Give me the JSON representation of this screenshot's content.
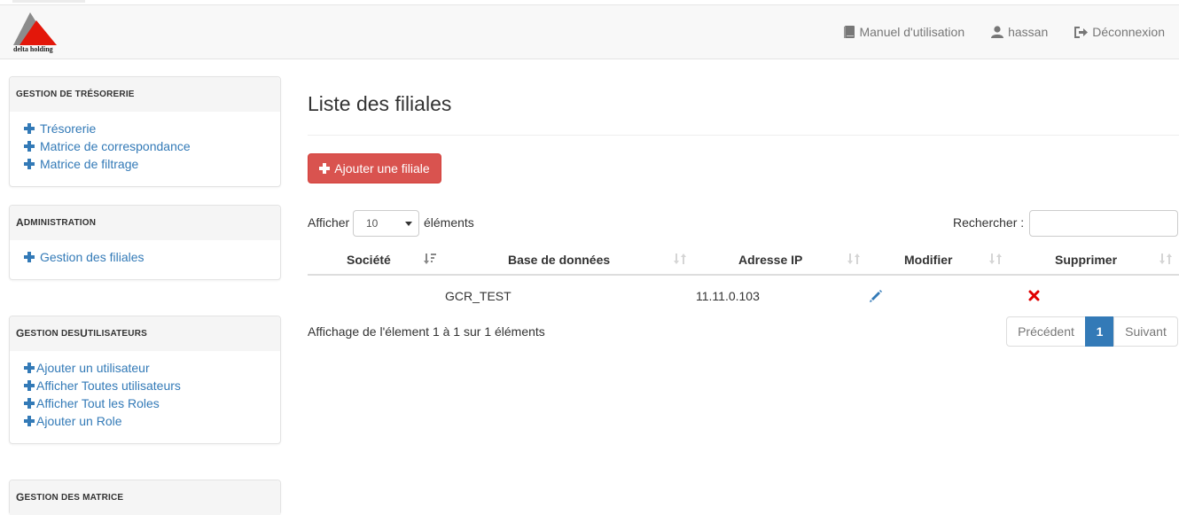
{
  "brand": {
    "logo_text": "delta holding"
  },
  "navbar": {
    "manual": "Manuel d'utilisation",
    "user": "hassan",
    "logout": "Déconnexion"
  },
  "sidebar": {
    "treasury": {
      "title": "GESTION DE TRÉSORERIE",
      "items": [
        "Trésorerie",
        "Matrice de correspondance",
        "Matrice de filtrage"
      ]
    },
    "admin": {
      "title_first": "A",
      "title_rest": "DMINISTRATION",
      "items": [
        "Gestion des filiales"
      ]
    },
    "users": {
      "title_parts": [
        "G",
        "ESTION DES ",
        "U",
        "TILISATEURS"
      ],
      "items": [
        "Ajouter un utilisateur",
        "Afficher Toutes utilisateurs",
        "Afficher Tout les Roles",
        "Ajouter un Role"
      ]
    },
    "matrix": {
      "title_first": "G",
      "title_rest": "ESTION DES MATRICE"
    }
  },
  "main": {
    "title": "Liste des filiales",
    "add_button": "Ajouter une filiale",
    "length": {
      "prefix": "Afficher",
      "value": "10",
      "suffix": "éléments"
    },
    "search_label": "Rechercher :",
    "columns": [
      "Société",
      "Base de données",
      "Adresse IP",
      "Modifier",
      "Supprimer"
    ],
    "rows": [
      {
        "societe": "",
        "base": "GCR_TEST",
        "ip": "11.11.0.103"
      }
    ],
    "info": "Affichage de l'élement 1 à 1 sur 1 éléments",
    "pagination": {
      "prev": "Précédent",
      "current": "1",
      "next": "Suivant"
    }
  },
  "colors": {
    "accent": "#337ab7",
    "danger": "#d9534f",
    "delete": "#e00000"
  }
}
